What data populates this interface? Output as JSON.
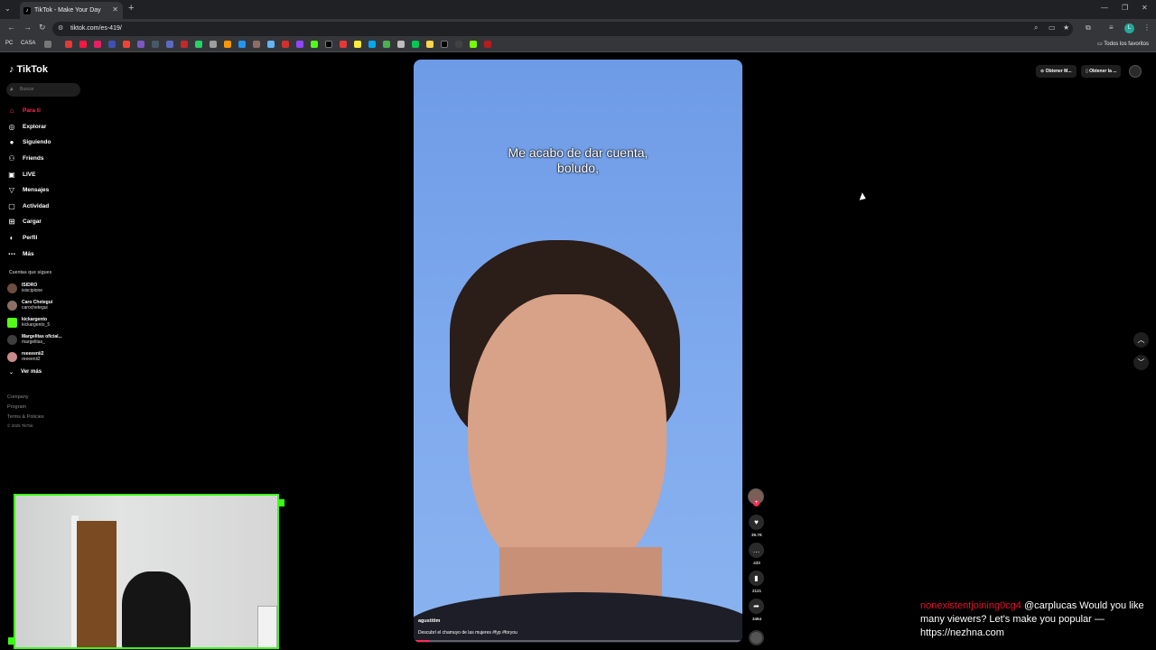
{
  "browser": {
    "tab_title": "TikTok - Make Your Day",
    "url": "tiktok.com/es-419/",
    "bookmark_pc": "PC",
    "bookmark_casa": "CASA",
    "bookmarks_all": "Todos los favoritos"
  },
  "tiktok": {
    "logo": "TikTok",
    "search_placeholder": "Buscar",
    "nav": [
      {
        "label": "Para ti",
        "icon": "home-icon"
      },
      {
        "label": "Explorar",
        "icon": "compass-icon"
      },
      {
        "label": "Siguiendo",
        "icon": "following-icon"
      },
      {
        "label": "Friends",
        "icon": "friends-icon"
      },
      {
        "label": "LIVE",
        "icon": "live-icon"
      },
      {
        "label": "Mensajes",
        "icon": "messages-icon"
      },
      {
        "label": "Actividad",
        "icon": "activity-icon"
      },
      {
        "label": "Cargar",
        "icon": "upload-icon"
      },
      {
        "label": "Perfil",
        "icon": "profile-icon"
      },
      {
        "label": "Más",
        "icon": "more-icon"
      }
    ],
    "following_header": "Cuentas que sigues",
    "accounts": [
      {
        "name": "ISIDRO",
        "handle": "isiscipione"
      },
      {
        "name": "Caro Chetegui",
        "handle": "carochetegui"
      },
      {
        "name": "kickargento",
        "handle": "kickargento_5"
      },
      {
        "name": "Margelitas oficial...",
        "handle": "margelitas_"
      },
      {
        "name": "reeeeenii2",
        "handle": "reeeenii2"
      }
    ],
    "ver_mas": "Ver más",
    "footer": [
      "Company",
      "Program",
      "Terms & Policies"
    ],
    "copyright": "© 2025 TikTok",
    "top_buttons": [
      "Obtener M...",
      "Obtener la ..."
    ],
    "video": {
      "caption_line1": "Me acabo de dar cuenta,",
      "caption_line2": "boludo,",
      "username": "agustitim",
      "description": "Descubrí el chamuyo de las mujeres #fyp #foryou",
      "progress": 0.05
    },
    "actions": {
      "likes": "39.7K",
      "comments": "433",
      "saves": "2121",
      "shares": "3464"
    }
  },
  "chat": {
    "user": "nonexistentjoining0cg4",
    "message": "@carplucas Would you like many viewers? Let's make you popular — https://nezhna.com"
  }
}
